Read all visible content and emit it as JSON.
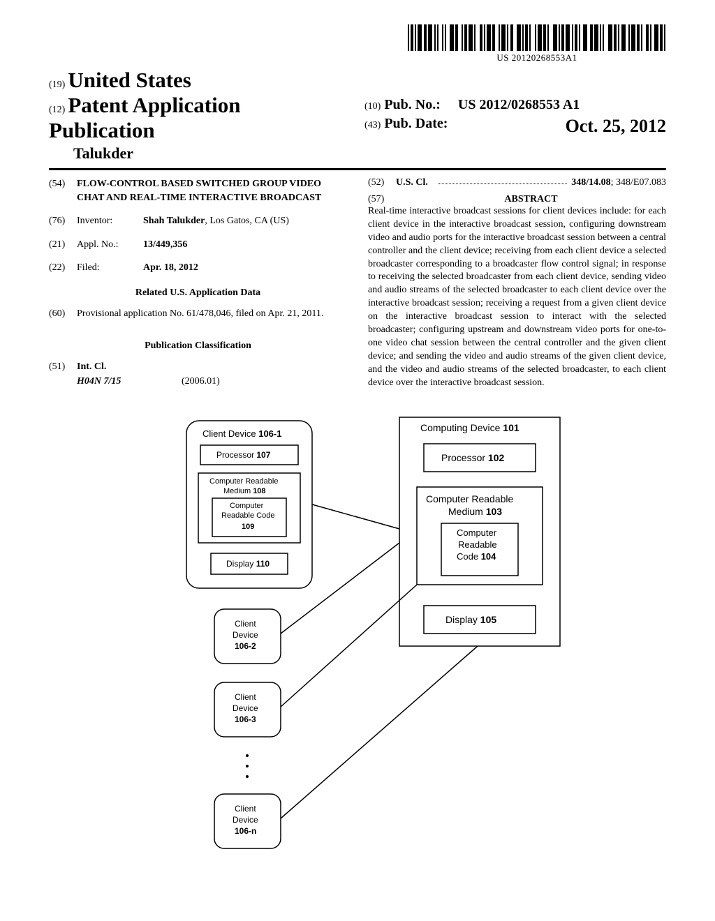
{
  "barcode_number": "US 20120268553A1",
  "header": {
    "code19": "(19)",
    "country": "United States",
    "code12": "(12)",
    "pub_type": "Patent Application Publication",
    "inventor_surname": "Talukder",
    "code10": "(10)",
    "pub_no_label": "Pub. No.:",
    "pub_no": "US 2012/0268553 A1",
    "code43": "(43)",
    "pub_date_label": "Pub. Date:",
    "pub_date": "Oct. 25, 2012"
  },
  "fields": {
    "code54": "(54)",
    "title": "FLOW-CONTROL BASED SWITCHED GROUP VIDEO CHAT AND REAL-TIME INTERACTIVE BROADCAST",
    "code76": "(76)",
    "inventor_label": "Inventor:",
    "inventor_name": "Shah Talukder",
    "inventor_loc": ", Los Gatos, CA (US)",
    "code21": "(21)",
    "applno_label": "Appl. No.:",
    "applno": "13/449,356",
    "code22": "(22)",
    "filed_label": "Filed:",
    "filed_date": "Apr. 18, 2012",
    "related_heading": "Related U.S. Application Data",
    "code60": "(60)",
    "related_text": "Provisional application No. 61/478,046, filed on Apr. 21, 2011.",
    "pubclass_heading": "Publication Classification",
    "code51": "(51)",
    "intcl_label": "Int. Cl.",
    "intcl_class": "H04N 7/15",
    "intcl_year": "(2006.01)",
    "code52": "(52)",
    "uscl_label": "U.S. Cl.",
    "uscl_value_bold": "348/14.08",
    "uscl_value_rest": "; 348/E07.083",
    "code57": "(57)",
    "abstract_heading": "ABSTRACT",
    "abstract_text": "Real-time interactive broadcast sessions for client devices include: for each client device in the interactive broadcast session, configuring downstream video and audio ports for the interactive broadcast session between a central controller and the client device; receiving from each client device a selected broadcaster corresponding to a broadcaster flow control signal; in response to receiving the selected broadcaster from each client device, sending video and audio streams of the selected broadcaster to each client device over the interactive broadcast session; receiving a request from a given client device on the interactive broadcast session to interact with the selected broadcaster; configuring upstream and downstream video ports for one-to-one video chat session between the central controller and the given client device; and sending the video and audio streams of the given client device, and the video and audio streams of the selected broadcaster, to each client device over the interactive broadcast session."
  },
  "figure": {
    "client_device": "Client Device",
    "client_device_num1": "106-1",
    "processor": "Processor",
    "processor_num1": "107",
    "crm": "Computer Readable",
    "medium": "Medium",
    "crm_num1": "108",
    "crc": "Computer",
    "readable_code": "Readable Code",
    "crc_num1": "109",
    "display": "Display",
    "display_num1": "110",
    "device": "Device",
    "client": "Client",
    "num2": "106-2",
    "num3": "106-3",
    "numN": "106-n",
    "computing_device": "Computing Device",
    "computing_device_num": "101",
    "processor_num2": "102",
    "crm_num2": "103",
    "readable": "Readable",
    "code": "Code",
    "crc_num2": "104",
    "display_num2": "105"
  }
}
